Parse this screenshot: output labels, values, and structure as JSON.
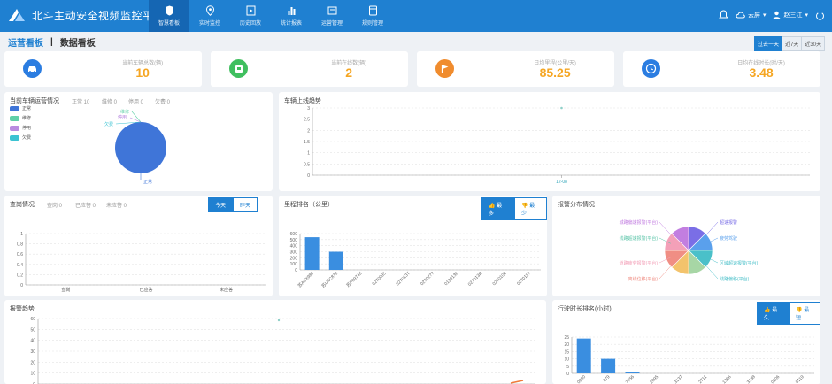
{
  "app": {
    "title": "北斗主动安全视频监控平台"
  },
  "nav": [
    {
      "label": "智慧看板",
      "icon": "shield-icon",
      "active": true
    },
    {
      "label": "实时监控",
      "icon": "location-pin-icon"
    },
    {
      "label": "历史回放",
      "icon": "playback-icon"
    },
    {
      "label": "统计报表",
      "icon": "bar-chart-icon"
    },
    {
      "label": "运营管理",
      "icon": "operations-icon"
    },
    {
      "label": "规则管理",
      "icon": "rules-icon"
    }
  ],
  "topright": {
    "cloud": "云屏",
    "user": "赵三江"
  },
  "page_tabs": {
    "active": "运营看板",
    "separator": "|",
    "other": "数据看板"
  },
  "range": [
    "过去一天",
    "近7天",
    "近30天"
  ],
  "stats": [
    {
      "label": "当前车辆总数(辆)",
      "value": "10",
      "icon": "car-icon",
      "color": "#2b7de1"
    },
    {
      "label": "当前在线数(辆)",
      "value": "2",
      "icon": "online-vehicle-icon",
      "color": "#40bf5f"
    },
    {
      "label": "日均里程(公里/天)",
      "value": "85.25",
      "icon": "flag-icon",
      "color": "#f08c2e"
    },
    {
      "label": "日均在线时长(时/天)",
      "value": "3.48",
      "icon": "clock-icon",
      "color": "#2b7de1"
    }
  ],
  "vehicle_ops": {
    "title": "当前车辆运营情况",
    "counts": [
      "正常 10",
      "维修 0",
      "停用 0",
      "欠费 0"
    ],
    "legend": [
      {
        "label": "正常",
        "color": "#3f75d8"
      },
      {
        "label": "维修",
        "color": "#5fd0a8"
      },
      {
        "label": "停用",
        "color": "#b98be0"
      },
      {
        "label": "欠费",
        "color": "#3cc3d2"
      }
    ],
    "pie_labels": [
      "维修",
      "停用",
      "欠费",
      "正常"
    ]
  },
  "online_trend": {
    "title": "车辆上线趋势"
  },
  "query": {
    "title": "查岗情况",
    "counts": [
      "查岗 0",
      "已应答 0",
      "未应答 0"
    ],
    "buttons": [
      "今天",
      "昨天"
    ]
  },
  "mileage": {
    "title": "里程排名（公里）",
    "buttons": [
      "最多",
      "最少"
    ]
  },
  "alarm_dist": {
    "title": "报警分布情况",
    "labels_left": [
      "城路偏速报警(平台)",
      "线路超速报警(平台)",
      "道路疲劳报警(平台)",
      "离线位移(平台)"
    ],
    "labels_right": [
      "超速报警",
      "疲劳驾驶",
      "区域超速报警(平台)",
      "线路偏移(平台)"
    ]
  },
  "alarm_trend": {
    "title": "报警趋势"
  },
  "drive_time": {
    "title": "行驶时长排名(小时)",
    "buttons": [
      "最久",
      "最短"
    ]
  },
  "chart_data": [
    {
      "type": "line",
      "name": "online_trend",
      "categories": [
        "12-08"
      ],
      "values": [
        3
      ],
      "ylim": [
        0,
        3
      ],
      "yticks": [
        0,
        0.5,
        1,
        1.5,
        2,
        2.5,
        3
      ]
    },
    {
      "type": "bar",
      "name": "query",
      "categories": [
        "查岗",
        "已应答",
        "未应答"
      ],
      "values": [
        0,
        0,
        0
      ],
      "ylim": [
        0,
        1
      ],
      "yticks": [
        0,
        0.2,
        0.4,
        0.6,
        0.8,
        1
      ]
    },
    {
      "type": "bar",
      "name": "mileage",
      "categories": [
        "苏A9X980",
        "苏U4C879",
        "苏P0974d",
        "0270095",
        "027013T",
        "02702??",
        "0120136",
        "027013R",
        "0270106",
        "027011?"
      ],
      "values": [
        540,
        300,
        0,
        0,
        0,
        0,
        0,
        0,
        0,
        0
      ],
      "ylim": [
        0,
        600
      ],
      "yticks": [
        0,
        100,
        200,
        300,
        400,
        500,
        600
      ]
    },
    {
      "type": "pie",
      "name": "alarm_dist",
      "values": [
        1,
        1,
        1,
        1,
        1,
        1,
        1,
        1
      ],
      "colors": [
        "#7a6ee6",
        "#5aa0ec",
        "#4ac0c9",
        "#a7d6a5",
        "#f3c36c",
        "#f08e84",
        "#f3a0b8",
        "#c27ee0"
      ]
    },
    {
      "type": "line",
      "name": "alarm_trend",
      "ylim": [
        0,
        60
      ],
      "yticks": [
        0,
        10,
        20,
        30,
        40,
        50,
        60
      ]
    },
    {
      "type": "bar",
      "name": "drive_time",
      "categories": [
        "0980",
        "879",
        "7756",
        "2095",
        "3137",
        "2711",
        "1366",
        "3138",
        "0106",
        "0119"
      ],
      "values": [
        24,
        10,
        1,
        0,
        0,
        0,
        0,
        0,
        0,
        0
      ],
      "ylim": [
        0,
        25
      ],
      "yticks": [
        0,
        5,
        10,
        15,
        20,
        25
      ]
    }
  ]
}
